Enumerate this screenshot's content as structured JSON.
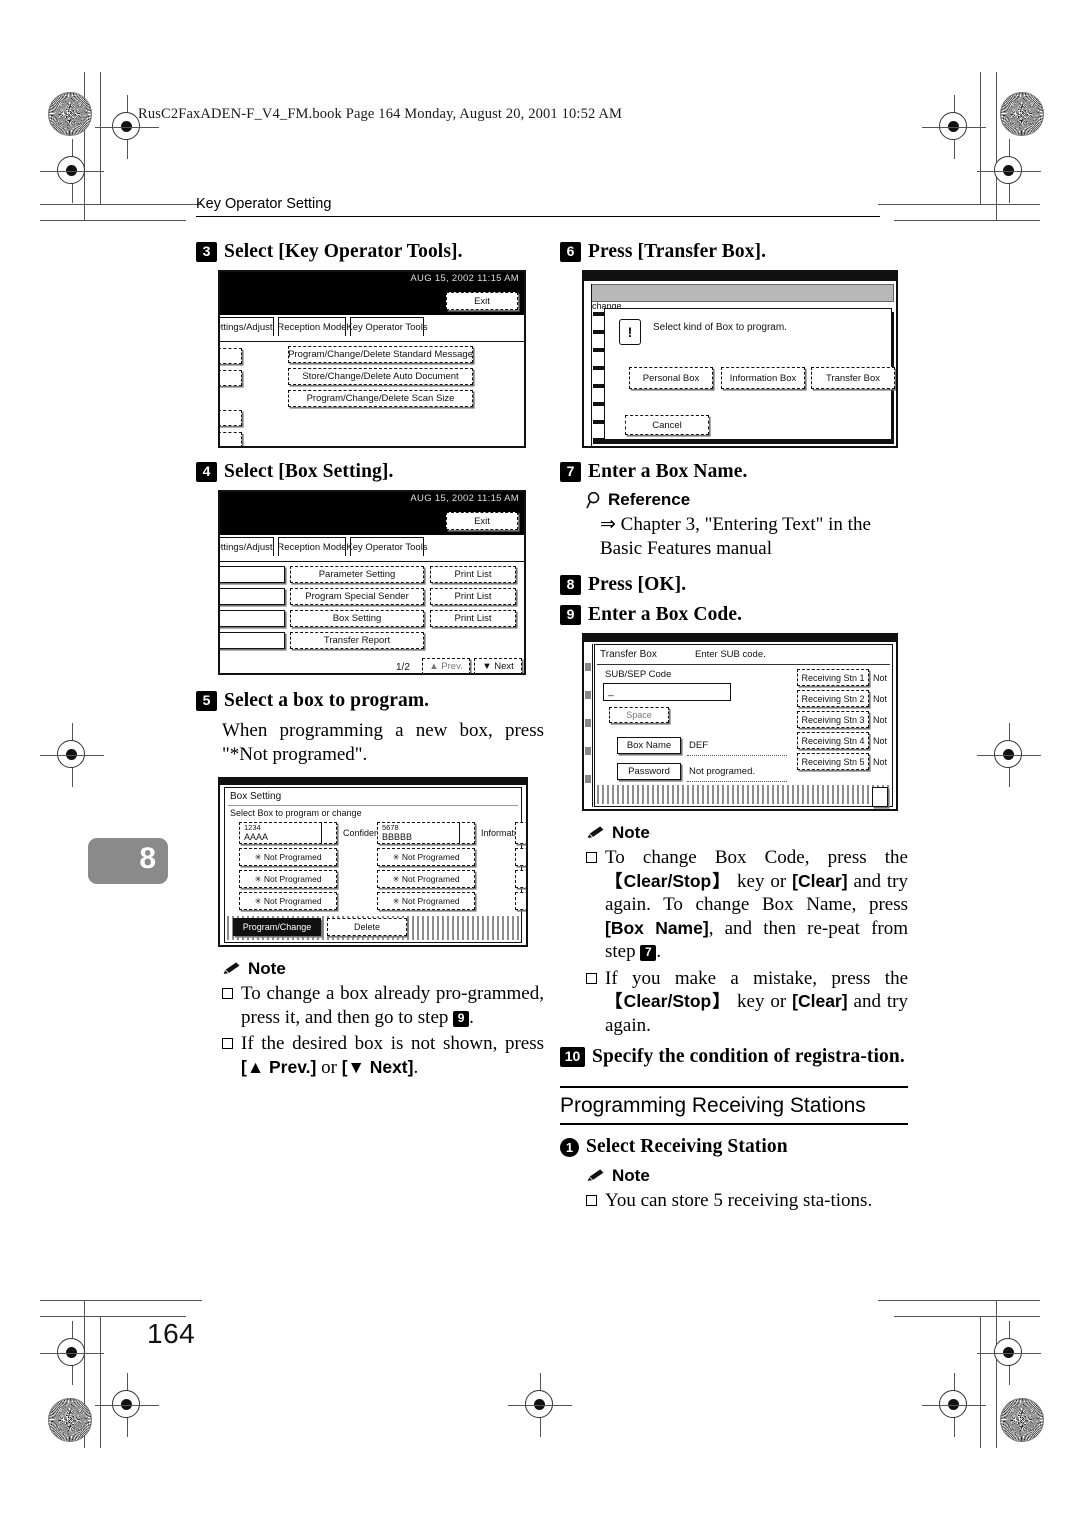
{
  "file_header": "RusC2FaxADEN-F_V4_FM.book  Page 164  Monday, August 20, 2001  10:52 AM",
  "running_head": "Key Operator Setting",
  "chapter_tab": "8",
  "folio": "164",
  "left_column": {
    "step3": {
      "num": "3",
      "text": "Select [Key Operator Tools]."
    },
    "shot3": {
      "timestamp": "AUG 15, 2002  11:15 AM",
      "exit_label": "Exit",
      "tabs": [
        "ettings/Adjust",
        "Reception Mode",
        "Key Operator Tools"
      ],
      "buttons": [
        "Program/Change/Delete Standard Message",
        "Store/Change/Delete Auto Document",
        "Program/Change/Delete Scan Size"
      ]
    },
    "step4": {
      "num": "4",
      "text": "Select [Box Setting]."
    },
    "shot4": {
      "timestamp": "AUG 15, 2002  11:15 AM",
      "exit_label": "Exit",
      "tabs": [
        "ettings/Adjust",
        "Reception Mode",
        "Key Operator Tools"
      ],
      "rows": [
        {
          "main": "Parameter Setting",
          "side": "Print List"
        },
        {
          "main": "Program Special Sender",
          "side": "Print List"
        },
        {
          "main": "Box Setting",
          "side": "Print List"
        },
        {
          "main": "Transfer Report",
          "side": ""
        }
      ],
      "page_indicator": "1/2",
      "prev_label": "Prev.",
      "next_label": "Next"
    },
    "step5": {
      "num": "5",
      "text": "Select a box to program."
    },
    "step5_body": "When programming a new box, press \"*Not programed\".",
    "shot5": {
      "title": "Box Setting",
      "subtitle": "Select Box to program or change",
      "box_a_code": "1234",
      "box_a_name": "AAAA",
      "box_a_kind": "Confidenti",
      "box_b_code": "5678",
      "box_b_name": "BBBBB",
      "box_b_kind": "Informatn",
      "not_programmed": "✳ Not Programed",
      "program_change_label": "Program/Change",
      "delete_label": "Delete"
    },
    "note": {
      "heading": "Note",
      "items": [
        {
          "pre": "To change a box already pro-grammed, press it, and then go to step ",
          "num": "9",
          "post": "."
        },
        {
          "pre": "If the desired box is not shown, press ",
          "bold1": "[▲ Prev.]",
          "mid": " or ",
          "bold2": "[▼ Next]",
          "post": "."
        }
      ]
    }
  },
  "right_column": {
    "step6": {
      "num": "6",
      "text": "Press [Transfer Box]."
    },
    "shot6": {
      "bg_label": "change",
      "dialog_message": "Select kind of Box to program.",
      "buttons": [
        "Personal Box",
        "Information Box",
        "Transfer Box"
      ],
      "cancel_label": "Cancel"
    },
    "step7": {
      "num": "7",
      "text": "Enter a Box Name."
    },
    "reference": {
      "heading": "Reference",
      "text": "⇒ Chapter 3, \"Entering Text\" in the Basic Features manual"
    },
    "step8": {
      "num": "8",
      "text": "Press [OK]."
    },
    "step9": {
      "num": "9",
      "text": "Enter a Box Code."
    },
    "shot9": {
      "title": "Transfer Box",
      "prompt": "Enter SUB code.",
      "code_label": "SUB/SEP Code",
      "code_value": "_",
      "space_label": "Space",
      "box_name_label": "Box Name",
      "box_name_value": "DEF",
      "password_label": "Password",
      "password_value": "Not programed.",
      "stations": [
        {
          "label": "Receiving Stn  1",
          "state": "Not"
        },
        {
          "label": "Receiving Stn  2",
          "state": "Not"
        },
        {
          "label": "Receiving Stn  3",
          "state": "Not"
        },
        {
          "label": "Receiving Stn  4",
          "state": "Not"
        },
        {
          "label": "Receiving Stn  5",
          "state": "Not"
        }
      ]
    },
    "note": {
      "heading": "Note",
      "item1": {
        "p1": "To change Box Code, press the ",
        "b1": "【Clear/Stop】",
        "p2": " key or ",
        "b2": "[Clear]",
        "p3": " and try again. To change Box Name, press ",
        "b3": "[Box Name]",
        "p4": ", and then re-peat from step ",
        "num": "7",
        "p5": "."
      },
      "item2": {
        "p1": "If you make a mistake, press the ",
        "b1": "【Clear/Stop】",
        "p2": " key or ",
        "b2": "[Clear]",
        "p3": " and try again."
      }
    },
    "step10": {
      "num": "10",
      "text": "Specify the condition of registra-tion."
    },
    "section": {
      "title": "Programming Receiving Stations"
    },
    "step_recv": {
      "num": "1",
      "text": "Select Receiving Station"
    },
    "note2": {
      "heading": "Note",
      "item": "You can store 5 receiving sta-tions."
    }
  }
}
